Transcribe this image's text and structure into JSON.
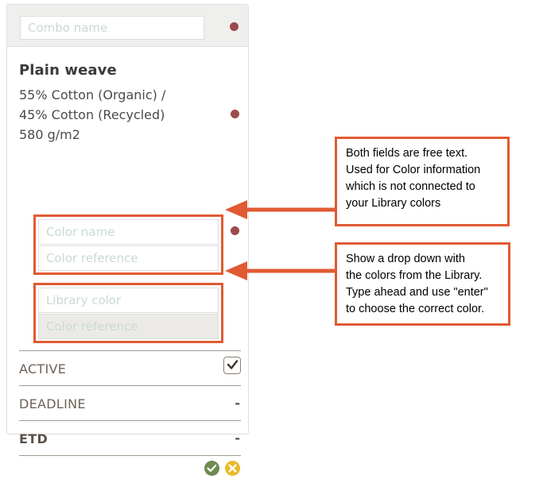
{
  "card": {
    "combo_name_placeholder": "Combo name",
    "product_title": "Plain weave",
    "composition": "55% Cotton (Organic) /\n45% Cotton (Recycled)\n580 g/m2",
    "free_text_group": {
      "color_name_placeholder": "Color name",
      "color_reference_placeholder": "Color reference"
    },
    "library_group": {
      "library_color_placeholder": "Library color",
      "color_reference_placeholder": "Color reference"
    },
    "attributes": [
      {
        "label": "ACTIVE",
        "value": ""
      },
      {
        "label": "DEADLINE",
        "value": "-"
      },
      {
        "label": "ETD",
        "value": "-"
      }
    ],
    "footer": {
      "confirm_label": "",
      "cancel_label": ""
    }
  },
  "annotations": [
    {
      "text": "Both fields are free text.\nUsed for Color information\nwhich is not connected to\nyour Library colors"
    },
    {
      "text": "Show a drop down with\nthe colors from the Library.\nType ahead and use \"enter\"\nto choose the correct color."
    }
  ],
  "colors": {
    "annotation_border": "#e05a33",
    "highlight_border": "#e05a33",
    "status_dot": "#9c4b4b",
    "confirm_button": "#6d8a4f",
    "cancel_button": "#e8ba2b",
    "placeholder_text": "#c9dad5",
    "row_divider": "#a59a90"
  }
}
